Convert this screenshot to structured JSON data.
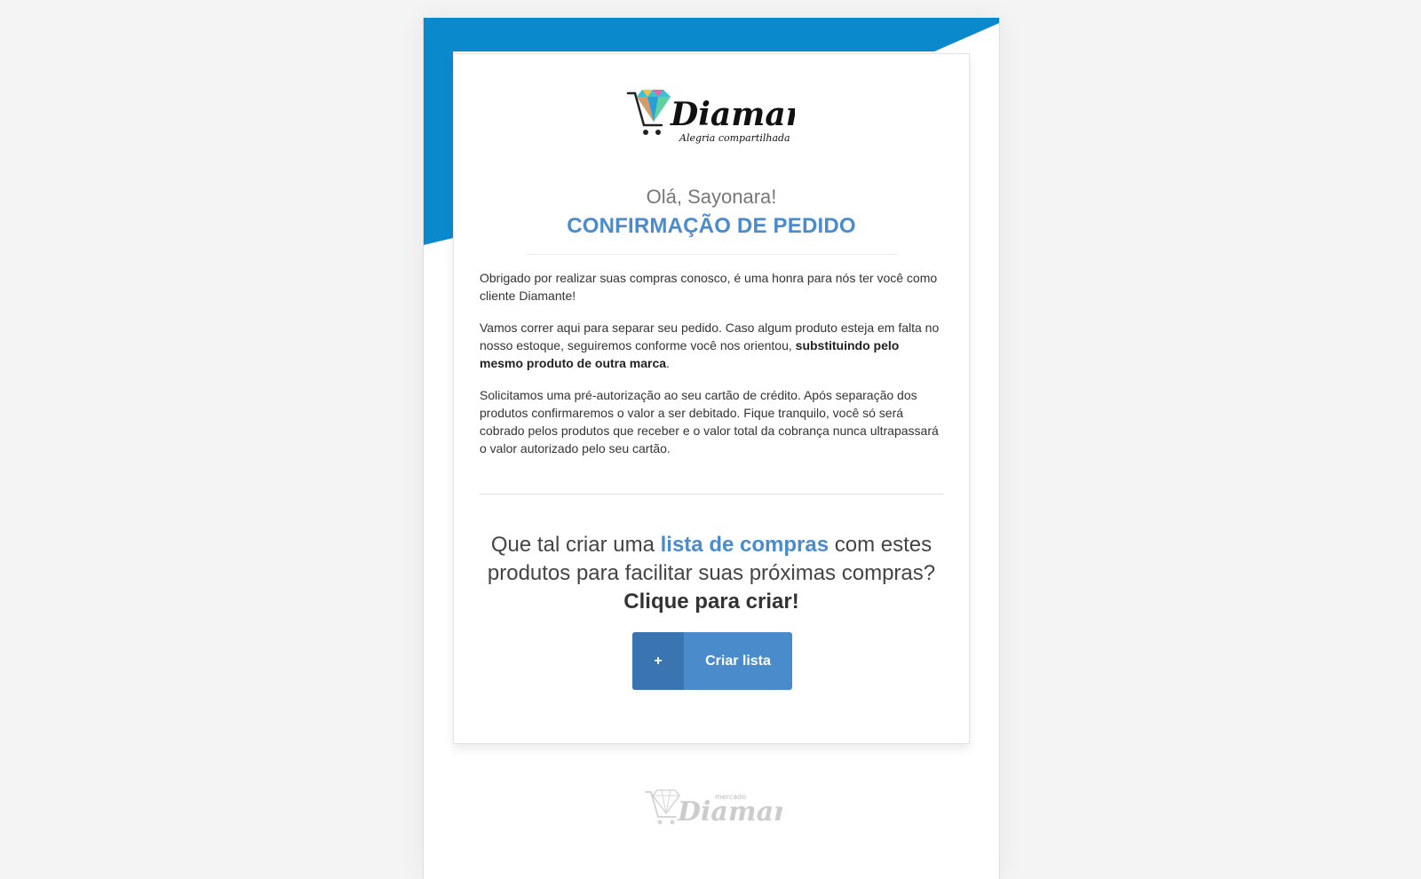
{
  "colors": {
    "brand_blue": "#0a8acd",
    "accent_blue": "#4a8bcc",
    "button_dark": "#3a75b1"
  },
  "logo": {
    "brand": "Diamante",
    "tagline": "Alegria compartilhada"
  },
  "greeting": "Olá, Sayonara!",
  "headline": "CONFIRMAÇÃO DE PEDIDO",
  "body": {
    "p1": "Obrigado por realizar suas compras conosco, é uma honra para nós ter você como cliente Diamante!",
    "p2_pre": "Vamos correr aqui para separar seu pedido. Caso algum produto esteja em falta no nosso estoque, seguiremos conforme você nos orientou, ",
    "p2_bold": "substituindo pelo mesmo produto de outra marca",
    "p2_post": ".",
    "p3": "Solicitamos uma pré-autorização ao seu cartão de crédito. Após separação dos produtos confirmaremos o valor a ser debitado. Fique tranquilo, você só será cobrado pelos produtos que receber e o valor total da cobrança nunca ultrapassará o valor autorizado pelo seu cartão."
  },
  "cta": {
    "pre": "Que tal criar uma ",
    "highlight": "lista de compras",
    "post": " com estes produtos para facilitar suas próximas compras?",
    "strong": "Clique para criar!",
    "button_icon": "+",
    "button_label": "Criar lista"
  },
  "footer_logo": {
    "small": "mercado",
    "brand": "Diamante"
  }
}
